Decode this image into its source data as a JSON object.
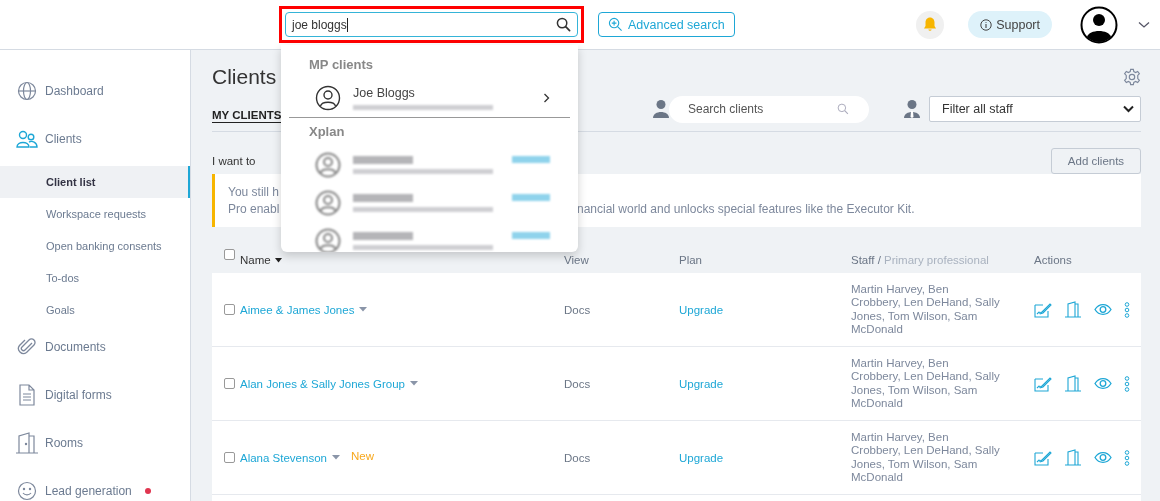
{
  "top_bar": {
    "search": {
      "value": "joe bloggs",
      "highlighted": true
    },
    "advanced_search": "Advanced search",
    "support": "Support"
  },
  "search_results": {
    "groups": [
      {
        "title": "MP clients",
        "results": [
          {
            "kind": "client",
            "name": "Joe Bloggs"
          }
        ]
      },
      {
        "title": "Xplan",
        "results": [
          {
            "kind": "import"
          },
          {
            "kind": "import"
          },
          {
            "kind": "import"
          }
        ]
      }
    ]
  },
  "sidebar": {
    "items": [
      {
        "label": "Dashboard",
        "selected": false,
        "alert": false
      },
      {
        "label": "Clients",
        "selected": false,
        "alert": false,
        "children": [
          {
            "label": "Client list",
            "selected": true
          },
          {
            "label": "Workspace requests",
            "selected": false
          },
          {
            "label": "Open banking consents",
            "selected": false
          },
          {
            "label": "To-dos",
            "selected": false
          },
          {
            "label": "Goals",
            "selected": false
          }
        ]
      },
      {
        "label": "Documents",
        "selected": false,
        "alert": false
      },
      {
        "label": "Digital forms",
        "selected": false,
        "alert": false
      },
      {
        "label": "Rooms",
        "selected": false,
        "alert": false
      },
      {
        "label": "Lead generation",
        "selected": false,
        "alert": true
      }
    ]
  },
  "page": {
    "title": "Clients",
    "tab": "MY CLIENTS",
    "search_placeholder": "Search clients",
    "staff_filter": "Filter all staff",
    "i_want_to": "I want to",
    "add_clients": "Add clients",
    "notice": {
      "line_1": "You still h",
      "line_2": "Pro enabl",
      "line_2_end": "nancial world and unlocks special features like the Executor Kit."
    }
  },
  "table": {
    "columns": {
      "name": "Name",
      "view": "View",
      "plan": "Plan",
      "staff": "Staff /",
      "staff_secondary": "Primary professional",
      "actions": "Actions"
    },
    "header_checked": false,
    "rows": [
      {
        "checked": false,
        "name": "Aimee & James Jones",
        "view": "Docs",
        "plan": "Upgrade",
        "staff": "Martin Harvey, Ben Crobbery, Len DeHand, Sally Jones, Tom Wilson, Sam McDonald"
      },
      {
        "checked": false,
        "name": "Alan Jones & Sally Jones Group",
        "view": "Docs",
        "plan": "Upgrade",
        "staff": "Martin Harvey, Ben Crobbery, Len DeHand, Sally Jones, Tom Wilson, Sam McDonald"
      },
      {
        "checked": false,
        "name": "Alana Stevenson",
        "badge": "New",
        "view": "Docs",
        "plan": "Upgrade",
        "staff": "Martin Harvey, Ben Crobbery, Len DeHand, Sally Jones, Tom Wilson, Sam McDonald"
      }
    ]
  }
}
